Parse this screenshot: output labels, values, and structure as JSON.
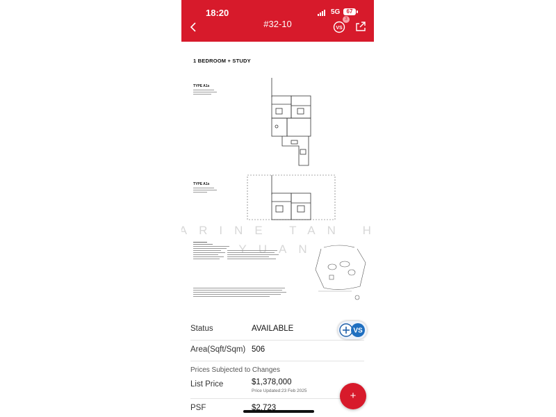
{
  "status_bar": {
    "time": "18:20",
    "network": "5G",
    "battery": "67"
  },
  "header": {
    "title": "#32-10",
    "compare_badge": "3",
    "back_icon": "chevron-left-icon",
    "compare_icon": "vs-icon",
    "share_icon": "share-icon",
    "bg_color": "#d71a2b"
  },
  "floor_plan": {
    "heading": "1 BEDROOM + STUDY",
    "type_1": "TYPE A1s",
    "type_2": "TYPE A1s",
    "watermark_line1": "SHARINE TAN HUI",
    "watermark_line2": "YUAN"
  },
  "details": {
    "status_label": "Status",
    "status_value": "AVAILABLE",
    "area_label": "Area(Sqft/Sqm)",
    "area_value": "506",
    "notice": "Prices Subjected to Changes",
    "list_price_label": "List Price",
    "list_price_value": "$1,378,000",
    "price_updated": "Price Updated:23 Feb 2025",
    "psf_label": "PSF",
    "psf_value": "$2,723"
  },
  "fab": {
    "label": "+"
  }
}
